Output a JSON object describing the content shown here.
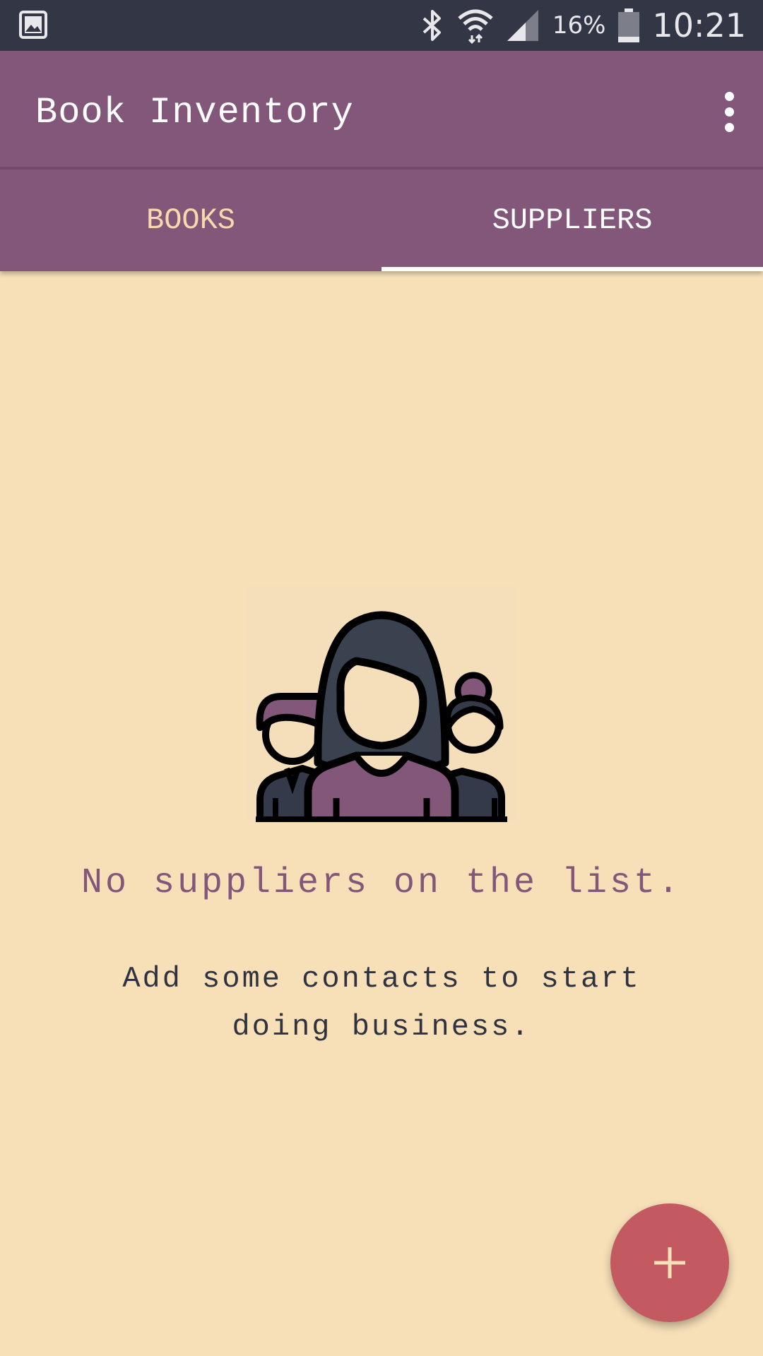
{
  "status_bar": {
    "battery_percent": "16%",
    "time": "10:21",
    "icons": [
      "gallery-icon",
      "bluetooth-icon",
      "wifi-icon",
      "cell-signal-icon",
      "battery-icon"
    ]
  },
  "app_bar": {
    "title": "Book Inventory",
    "overflow_icon": "more-vert-icon"
  },
  "tabs": [
    {
      "label": "BOOKS",
      "selected": false
    },
    {
      "label": "SUPPLIERS",
      "selected": true
    }
  ],
  "empty_state": {
    "icon": "team-people-icon",
    "title": "No suppliers on the list.",
    "subtitle": "Add some contacts to start doing business."
  },
  "fab": {
    "icon": "plus-icon",
    "color": "#c45a61"
  },
  "colors": {
    "primary": "#83577a",
    "background": "#f7e0b8",
    "status_bar": "#323645",
    "accent": "#c45a61"
  }
}
